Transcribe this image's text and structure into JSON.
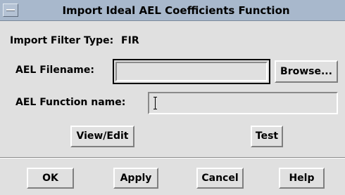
{
  "window": {
    "title": "Import Ideal AEL Coefficients Function"
  },
  "filter_type": {
    "label": "Import Filter Type:",
    "value": "FIR"
  },
  "ael_filename": {
    "label": "AEL Filename:",
    "value": "",
    "browse_label": "Browse..."
  },
  "ael_function_name": {
    "label": "AEL Function name:",
    "value": ""
  },
  "actions": {
    "view_edit_label": "View/Edit",
    "test_label": "Test"
  },
  "footer": {
    "ok_label": "OK",
    "apply_label": "Apply",
    "cancel_label": "Cancel",
    "help_label": "Help"
  }
}
